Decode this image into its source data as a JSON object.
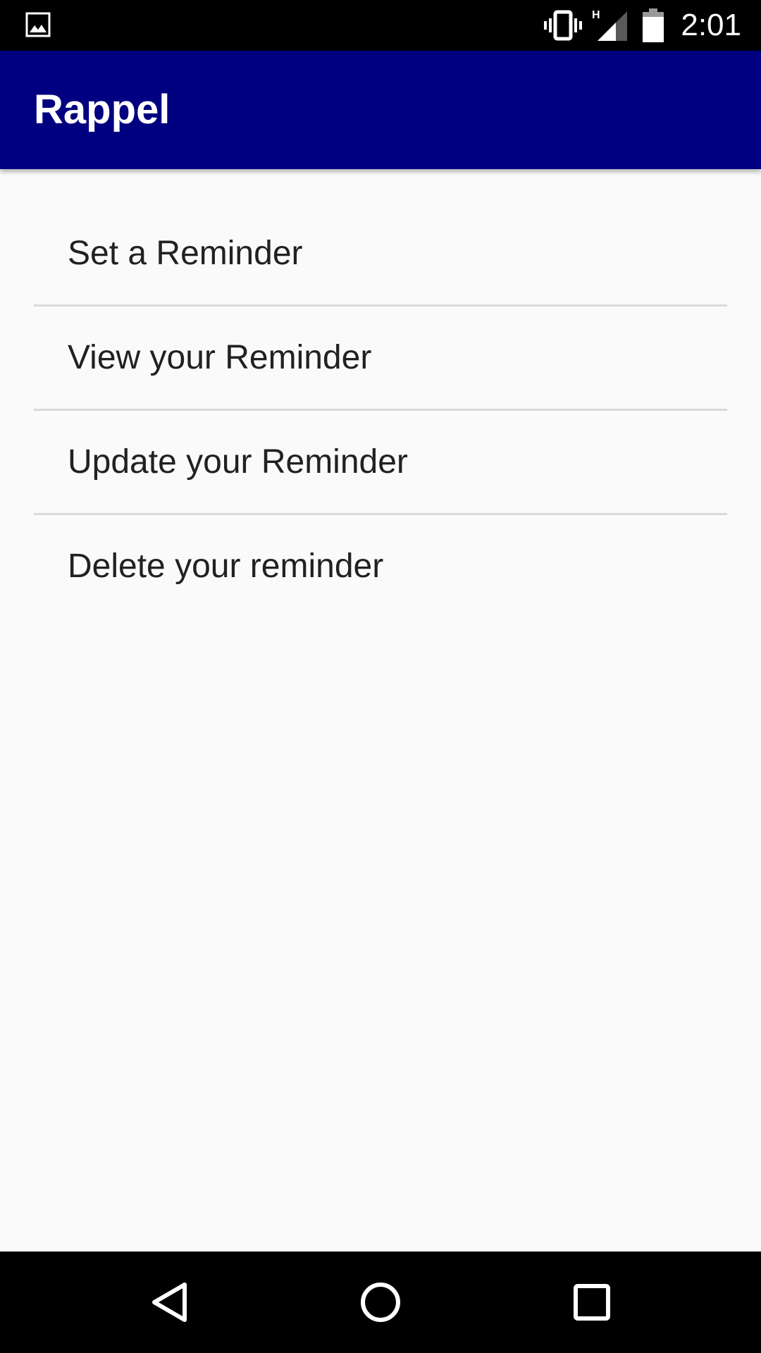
{
  "status_bar": {
    "left_icon": "image-notification-icon",
    "icons": [
      "vibrate-icon",
      "signal-h-icon",
      "battery-icon"
    ],
    "network_type": "H",
    "time": "2:01"
  },
  "app_bar": {
    "title": "Rappel",
    "color": "#000080"
  },
  "menu": {
    "items": [
      {
        "label": "Set a Reminder"
      },
      {
        "label": "View your Reminder"
      },
      {
        "label": "Update your Reminder"
      },
      {
        "label": "Delete your reminder"
      }
    ]
  },
  "nav_bar": {
    "buttons": [
      "back-icon",
      "home-icon",
      "recents-icon"
    ]
  }
}
